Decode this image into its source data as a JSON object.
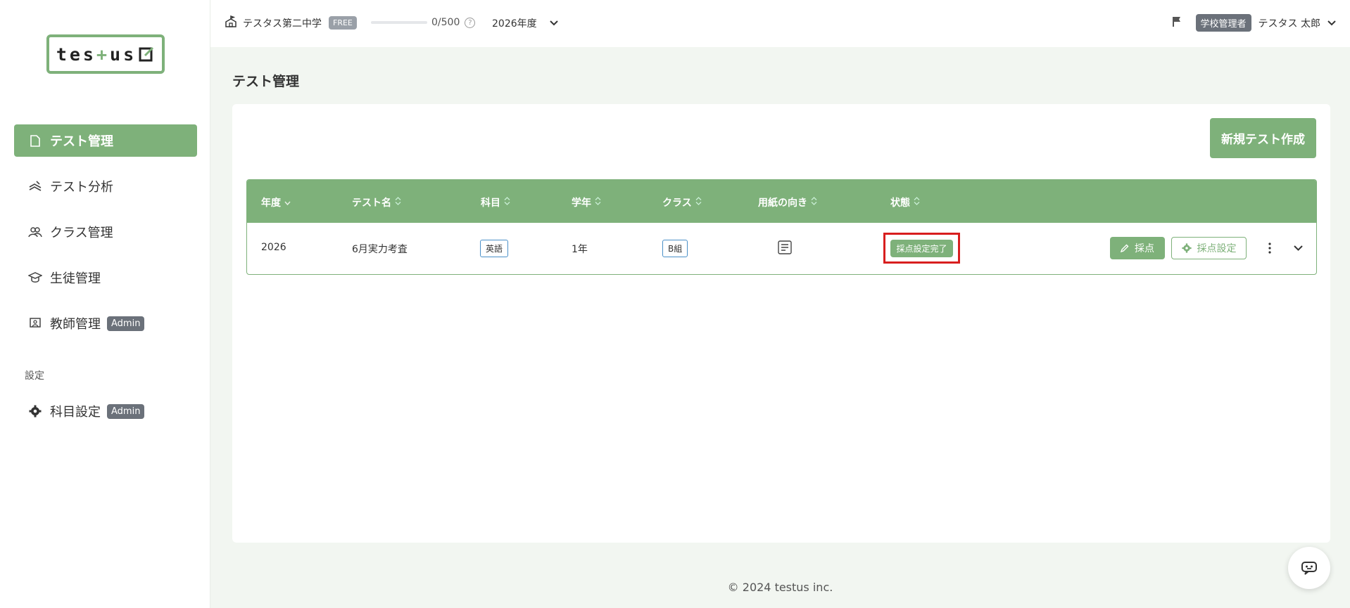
{
  "logo": {
    "text_left": "tes",
    "text_plus": "+",
    "text_right": "us"
  },
  "sidebar": {
    "items": [
      {
        "label": "テスト管理",
        "icon": "document-icon",
        "active": true
      },
      {
        "label": "テスト分析",
        "icon": "analysis-icon"
      },
      {
        "label": "クラス管理",
        "icon": "users-icon"
      },
      {
        "label": "生徒管理",
        "icon": "graduation-cap-icon"
      },
      {
        "label": "教師管理",
        "icon": "teacher-board-icon",
        "badge": "Admin"
      }
    ],
    "section_label": "設定",
    "settings_items": [
      {
        "label": "科目設定",
        "icon": "gear-icon",
        "badge": "Admin"
      }
    ]
  },
  "header": {
    "school_name": "テスタス第二中学",
    "plan": "FREE",
    "usage": "0/500",
    "usage_fraction": 0,
    "help": "?",
    "year": "2026年度",
    "role": "学校管理者",
    "user_name": "テスタス 太郎"
  },
  "main": {
    "title": "テスト管理",
    "new_test_button": "新規テスト作成",
    "columns": [
      "年度",
      "テスト名",
      "科目",
      "学年",
      "クラス",
      "用紙の向き",
      "状態"
    ],
    "rows": [
      {
        "year": "2026",
        "test_name": "6月実力考査",
        "subject": "英語",
        "grade": "1年",
        "class": "B組",
        "orientation": "portrait",
        "status": "採点設定完了",
        "grade_button": "採点",
        "settings_button": "採点設定"
      }
    ]
  },
  "footer": {
    "copyright": "© 2024 testus inc."
  },
  "colors": {
    "accent": "#7eb17a",
    "highlight": "#d81e1e",
    "badge_gray": "#6b717a"
  }
}
